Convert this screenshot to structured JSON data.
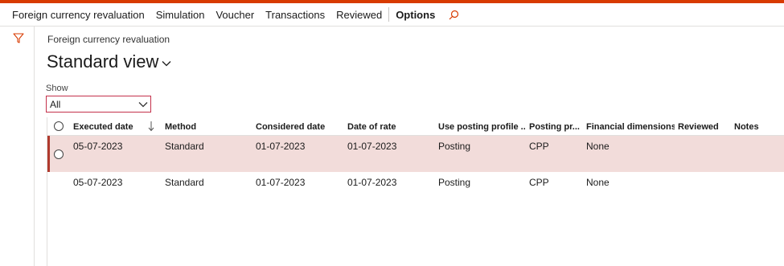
{
  "actionbar": {
    "items": [
      "Foreign currency revaluation",
      "Simulation",
      "Voucher",
      "Transactions",
      "Reviewed",
      "Options"
    ]
  },
  "page": {
    "caption": "Foreign currency revaluation",
    "view_title": "Standard view"
  },
  "filter": {
    "show_label": "Show",
    "show_value": "All"
  },
  "grid": {
    "columns": [
      "Executed date",
      "Method",
      "Considered date",
      "Date of rate",
      "Use posting profile ...",
      "Posting pr...",
      "Financial dimensions",
      "Reviewed",
      "Notes"
    ],
    "rows": [
      {
        "executed": "05-07-2023",
        "method": "Standard",
        "considered": "01-07-2023",
        "rate_date": "01-07-2023",
        "use_profile": "Posting",
        "posting_profile": "CPP",
        "fin_dims": "None",
        "reviewed": "",
        "notes": ""
      },
      {
        "executed": "05-07-2023",
        "method": "Standard",
        "considered": "01-07-2023",
        "rate_date": "01-07-2023",
        "use_profile": "Posting",
        "posting_profile": "CPP",
        "fin_dims": "None",
        "reviewed": "",
        "notes": ""
      }
    ]
  },
  "colors": {
    "accent": "#d83b01",
    "selected_row": "#f2dcda",
    "selected_bar": "#b03a2e",
    "invalid_border": "#c4314b"
  },
  "icons": [
    "filter-icon",
    "search-icon",
    "chevron-down-icon",
    "sort-descending-icon"
  ]
}
